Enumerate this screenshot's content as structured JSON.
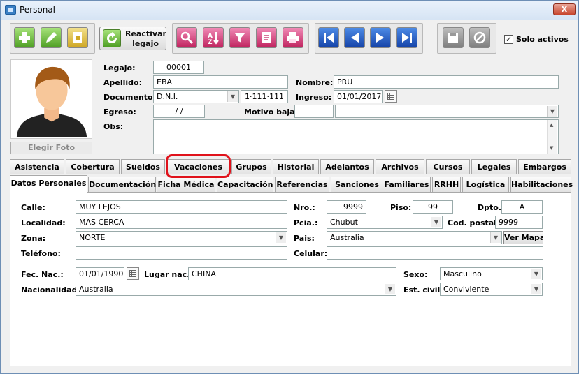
{
  "window": {
    "title": "Personal",
    "close": "X"
  },
  "toolbar": {
    "reactivar": "Reactivar legajo",
    "solo_activos": "Solo activos",
    "solo_activos_checked": true
  },
  "icons": [
    "add-icon",
    "edit-icon",
    "copy-icon",
    "reactivate-icon",
    "search-icon",
    "sort-az-icon",
    "filter-icon",
    "report-icon",
    "print-icon",
    "first-record-icon",
    "prev-record-icon",
    "next-record-icon",
    "last-record-icon",
    "save-icon",
    "cancel-icon"
  ],
  "form": {
    "legajo_label": "Legajo:",
    "legajo": "00001",
    "apellido_label": "Apellido:",
    "apellido": "EBA",
    "nombre_label": "Nombre:",
    "nombre": "PRU",
    "documento_label": "Documento:",
    "doc_tipo": "D.N.I.",
    "doc_num": "1·111·111",
    "ingreso_label": "Ingreso:",
    "ingreso": "01/01/2017",
    "egreso_label": "Egreso:",
    "egreso": "/ /",
    "motivo_label": "Motivo baja:",
    "motivo": "",
    "obs_label": "Obs:",
    "obs": "",
    "elegir_foto": "Elegir Foto"
  },
  "tabs_row1": [
    "Asistencia",
    "Cobertura",
    "Sueldos",
    "Vacaciones",
    "Grupos",
    "Historial",
    "Adelantos",
    "Archivos",
    "Cursos",
    "Legales",
    "Embargos"
  ],
  "tabs_row2": [
    "Datos Personales",
    "Documentación",
    "Ficha Médica",
    "Capacitación",
    "Referencias",
    "Sanciones",
    "Familiares",
    "RRHH",
    "Logística",
    "Habilitaciones"
  ],
  "datos": {
    "calle_label": "Calle:",
    "calle": "MUY LEJOS",
    "nro_label": "Nro.:",
    "nro": "9999",
    "piso_label": "Piso:",
    "piso": "99",
    "dpto_label": "Dpto.:",
    "dpto": "A",
    "localidad_label": "Localidad:",
    "localidad": "MAS CERCA",
    "pcia_label": "Pcia.:",
    "pcia": "Chubut",
    "cp_label": "Cod. postal:",
    "cp": "9999",
    "zona_label": "Zona:",
    "zona": "NORTE",
    "pais_label": "Pais:",
    "pais": "Australia",
    "ver_mapa": "Ver Mapa",
    "telefono_label": "Teléfono:",
    "telefono": "",
    "celular_label": "Celular:",
    "celular": "",
    "fecnac_label": "Fec. Nac.:",
    "fecnac": "01/01/1990",
    "lugar_label": "Lugar nac.:",
    "lugar": "CHINA",
    "sexo_label": "Sexo:",
    "sexo": "Masculino",
    "nacionalidad_label": "Nacionalidad:",
    "nacionalidad": "Australia",
    "civil_label": "Est. civil:",
    "civil": "Conviviente"
  }
}
